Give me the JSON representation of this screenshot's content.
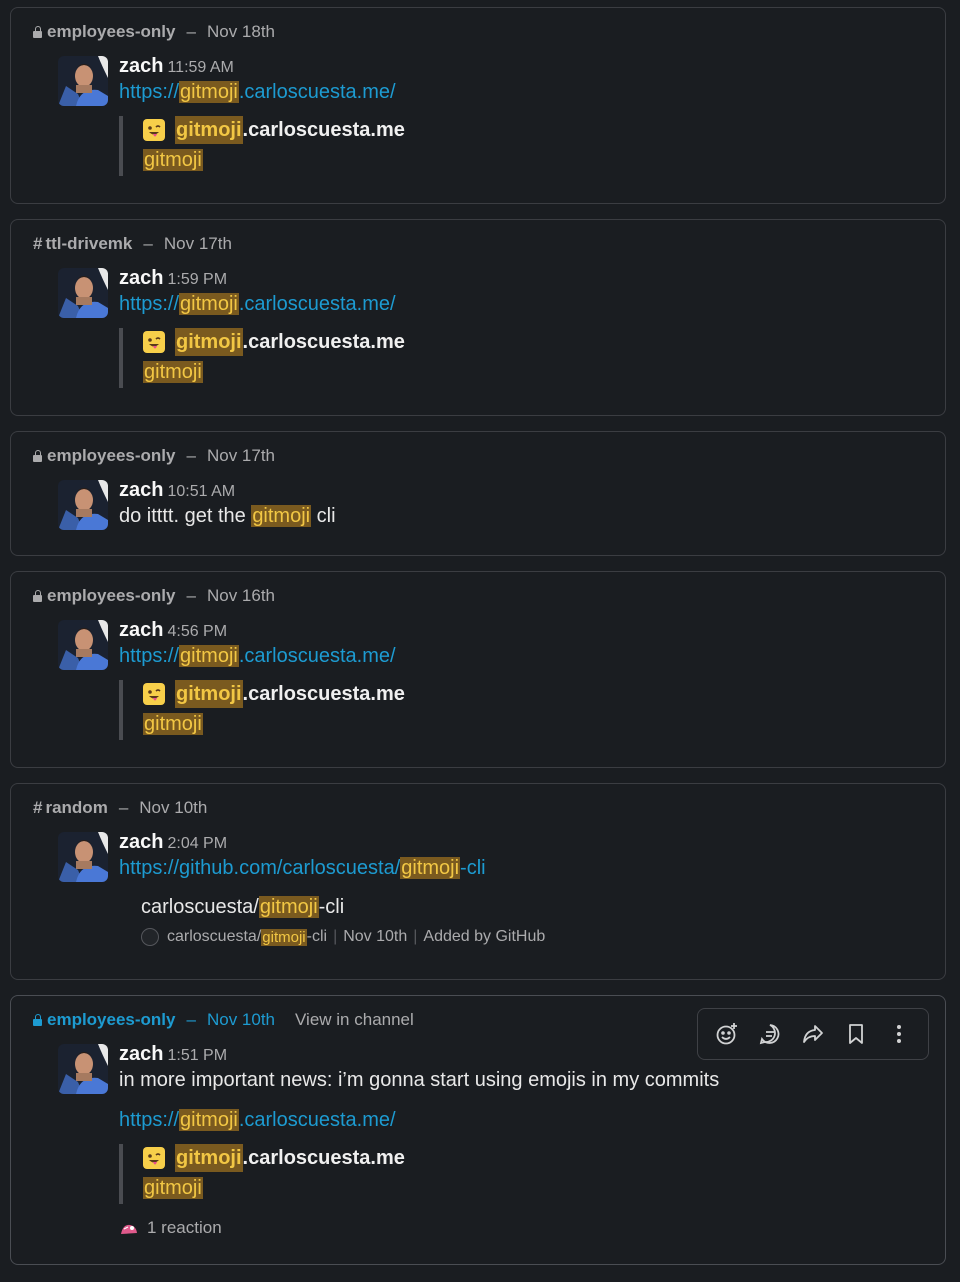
{
  "results": [
    {
      "channel": "employees-only",
      "channel_type": "private",
      "date": "Nov 18th",
      "user": "zach",
      "time": "11:59 AM",
      "lines": [],
      "url": {
        "pre": "https://",
        "hl": "gitmoji",
        "post": ".carloscuesta.me/"
      },
      "unfurl": {
        "site_hl": "gitmoji",
        "site_post": ".carloscuesta.me",
        "sub_hl": "gitmoji"
      }
    },
    {
      "channel": "ttl-drivemk",
      "channel_type": "public",
      "date": "Nov 17th",
      "user": "zach",
      "time": "1:59 PM",
      "url": {
        "pre": "https://",
        "hl": "gitmoji",
        "post": ".carloscuesta.me/"
      },
      "unfurl": {
        "site_hl": "gitmoji",
        "site_post": ".carloscuesta.me",
        "sub_hl": "gitmoji"
      }
    },
    {
      "channel": "employees-only",
      "channel_type": "private",
      "date": "Nov 17th",
      "user": "zach",
      "time": "10:51 AM",
      "text": {
        "pre": "do itttt. get the ",
        "hl": "gitmoji",
        "post": " cli"
      }
    },
    {
      "channel": "employees-only",
      "channel_type": "private",
      "date": "Nov 16th",
      "user": "zach",
      "time": "4:56 PM",
      "url": {
        "pre": "https://",
        "hl": "gitmoji",
        "post": ".carloscuesta.me/"
      },
      "unfurl": {
        "site_hl": "gitmoji",
        "site_post": ".carloscuesta.me",
        "sub_hl": "gitmoji"
      }
    },
    {
      "channel": "random",
      "channel_type": "public",
      "date": "Nov 10th",
      "user": "zach",
      "time": "2:04 PM",
      "url": {
        "pre": "https://github.com/carloscuesta/",
        "hl": "gitmoji",
        "post": "-cli"
      },
      "github": {
        "title_pre": "carloscuesta/",
        "title_hl": "gitmoji",
        "title_post": "-cli",
        "foot_pre": "carloscuesta/",
        "foot_hl": "gitmoji",
        "foot_post": "-cli",
        "date": "Nov 10th",
        "added_by": "Added by GitHub"
      }
    },
    {
      "channel": "employees-only",
      "channel_type": "private",
      "date": "Nov 10th",
      "view_in_channel": "View in channel",
      "user": "zach",
      "time": "1:51 PM",
      "text_plain": "in more important news: i’m gonna start using emojis in my commits",
      "url": {
        "pre": "https://",
        "hl": "gitmoji",
        "post": ".carloscuesta.me/"
      },
      "unfurl": {
        "site_hl": "gitmoji",
        "site_post": ".carloscuesta.me",
        "sub_hl": "gitmoji"
      },
      "reaction": "1 reaction",
      "toolbar": [
        "add-reaction-icon",
        "reply-in-thread-icon",
        "share-icon",
        "bookmark-icon",
        "more-actions-icon"
      ]
    }
  ],
  "colors": {
    "bg": "#1a1d21",
    "link": "#1d9bd1",
    "highlight_bg": "#7a5a1f",
    "highlight_fg": "#f2c744",
    "border": "#3b3d42"
  }
}
